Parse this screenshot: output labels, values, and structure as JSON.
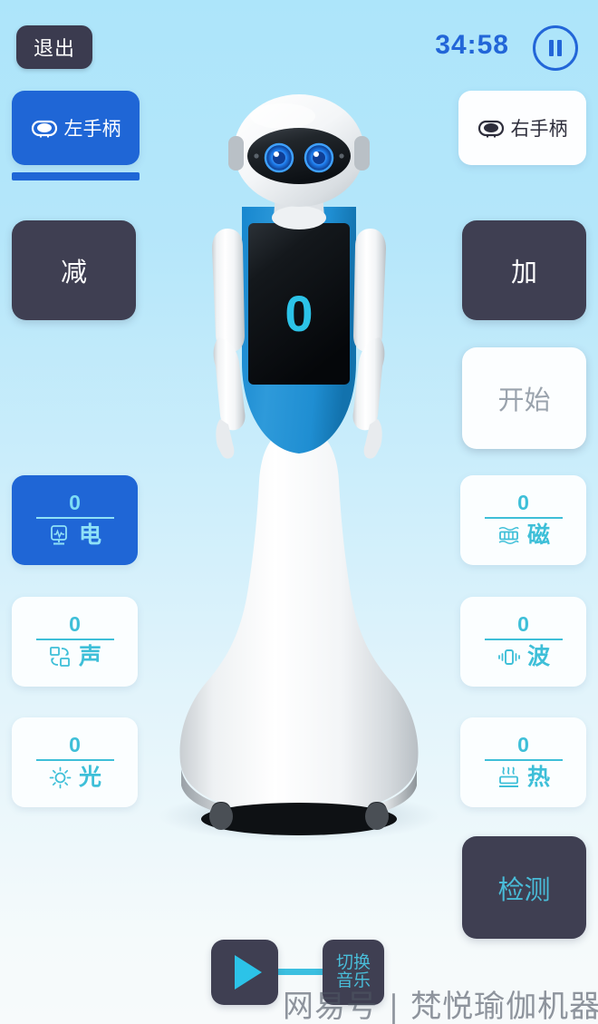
{
  "header": {
    "exit_label": "退出",
    "timer": "34:58",
    "pause_icon": "pause-icon"
  },
  "handles": [
    {
      "label": "左手柄",
      "icon": "gamepad-icon",
      "state": "active"
    },
    {
      "label": "右手柄",
      "icon": "gamepad-icon",
      "state": "idle"
    }
  ],
  "controls": {
    "minus_label": "减",
    "plus_label": "加",
    "start_label": "开始",
    "detect_label": "检测"
  },
  "robot": {
    "chest_value": "0"
  },
  "sensors": {
    "left": [
      {
        "value": "0",
        "label": "电",
        "icon": "ecg-monitor-icon",
        "state": "active"
      },
      {
        "value": "0",
        "label": "声",
        "icon": "sound-icon",
        "state": "idle"
      },
      {
        "value": "0",
        "label": "光",
        "icon": "sun-icon",
        "state": "idle"
      }
    ],
    "right": [
      {
        "value": "0",
        "label": "磁",
        "icon": "magnet-icon",
        "state": "idle"
      },
      {
        "value": "0",
        "label": "波",
        "icon": "vibration-wave-icon",
        "state": "idle"
      },
      {
        "value": "0",
        "label": "热",
        "icon": "heat-steam-icon",
        "state": "idle"
      }
    ]
  },
  "media": {
    "play_icon": "play-icon",
    "switch_line1": "切换",
    "switch_line2": "音乐"
  },
  "watermark": "网易号 | 梵悦瑜伽机器人",
  "colors": {
    "accent_blue": "#1f66d6",
    "timer_blue": "#2266d8",
    "cyan": "#3ebfd8",
    "dark": "#3f3f52",
    "bg_top": "#ade5fa",
    "bg_bottom": "#f7fafb"
  }
}
